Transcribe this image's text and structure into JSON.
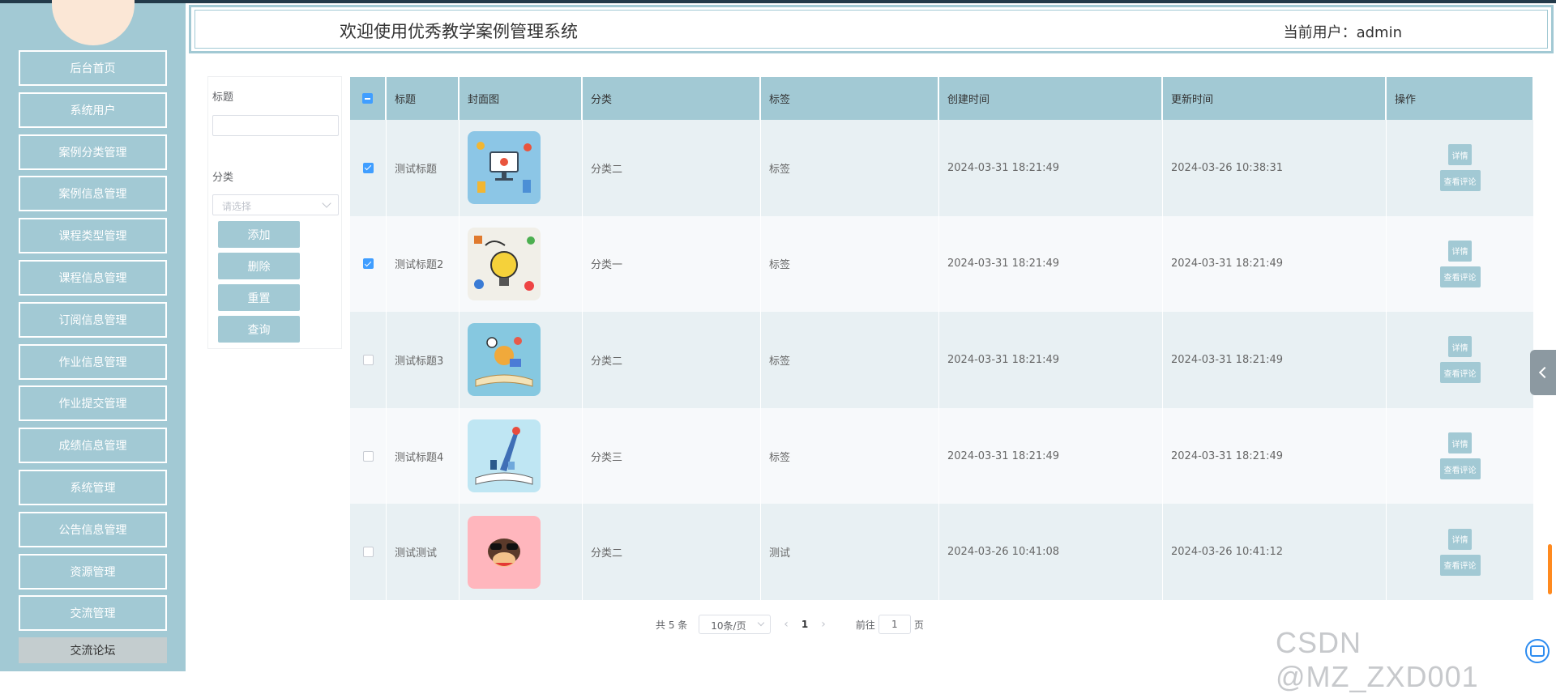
{
  "header": {
    "title": "欢迎使用优秀教学案例管理系统",
    "user": "当前用户：admin"
  },
  "sidebar": {
    "items": [
      {
        "label": "后台首页"
      },
      {
        "label": "系统用户"
      },
      {
        "label": "案例分类管理"
      },
      {
        "label": "案例信息管理"
      },
      {
        "label": "课程类型管理"
      },
      {
        "label": "课程信息管理"
      },
      {
        "label": "订阅信息管理"
      },
      {
        "label": "作业信息管理"
      },
      {
        "label": "作业提交管理"
      },
      {
        "label": "成绩信息管理"
      },
      {
        "label": "系统管理"
      },
      {
        "label": "公告信息管理"
      },
      {
        "label": "资源管理"
      },
      {
        "label": "交流管理"
      },
      {
        "label": "交流论坛"
      }
    ]
  },
  "search": {
    "title_label": "标题",
    "title_value": "",
    "category_label": "分类",
    "category_placeholder": "请选择",
    "buttons": {
      "add": "添加",
      "delete": "删除",
      "reset": "重置",
      "query": "查询"
    }
  },
  "table": {
    "columns": [
      "标题",
      "封面图",
      "分类",
      "标签",
      "创建时间",
      "更新时间",
      "操作"
    ],
    "rows": [
      {
        "title": "测试标题",
        "category": "分类二",
        "tag": "标签",
        "created": "2024-03-31 18:21:49",
        "updated": "2024-03-26 10:38:31",
        "checked": true,
        "cover": "computer-illustration"
      },
      {
        "title": "测试标题2",
        "category": "分类一",
        "tag": "标签",
        "created": "2024-03-31 18:21:49",
        "updated": "2024-03-31 18:21:49",
        "checked": true,
        "cover": "learn-lightbulb-illustration"
      },
      {
        "title": "测试标题3",
        "category": "分类二",
        "tag": "标签",
        "created": "2024-03-31 18:21:49",
        "updated": "2024-03-31 18:21:49",
        "checked": false,
        "cover": "open-book-illustration"
      },
      {
        "title": "测试标题4",
        "category": "分类三",
        "tag": "标签",
        "created": "2024-03-31 18:21:49",
        "updated": "2024-03-31 18:21:49",
        "checked": false,
        "cover": "book-rocket-illustration"
      },
      {
        "title": "测试测试",
        "category": "分类二",
        "tag": "测试",
        "created": "2024-03-26 10:41:08",
        "updated": "2024-03-26 10:41:12",
        "checked": false,
        "cover": "monkey-sunglasses-illustration"
      }
    ],
    "actions": {
      "detail": "详情",
      "comments": "查看评论"
    }
  },
  "pagination": {
    "total": "共 5 条",
    "page_size": "10条/页",
    "current_page": "1",
    "goto_prefix": "前往",
    "goto_value": "1",
    "goto_suffix": "页"
  },
  "watermark": "CSDN @MZ_ZXD001",
  "colors": {
    "accent": "#a2c9d4",
    "checkbox": "#409eff",
    "row_odd": "#e8f0f3",
    "row_even": "#f7f9fb"
  }
}
